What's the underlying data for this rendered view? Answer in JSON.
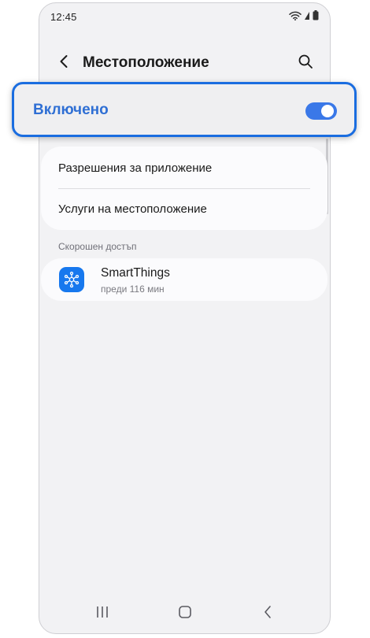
{
  "status_bar": {
    "time": "12:45",
    "icons": [
      "wifi-icon",
      "signal-icon",
      "battery-icon"
    ]
  },
  "header": {
    "title": "Местоположение",
    "back_icon": "chevron-left-icon",
    "search_icon": "search-icon"
  },
  "location_toggle": {
    "label": "Включено",
    "state": "on"
  },
  "menu": {
    "items": [
      {
        "label": "Разрешения за приложение"
      },
      {
        "label": "Услуги на местоположение"
      }
    ]
  },
  "recent_access": {
    "section_label": "Скорошен достъп",
    "apps": [
      {
        "name": "SmartThings",
        "time": "преди 116 мин",
        "icon": "smartthings-icon"
      }
    ]
  },
  "nav_bar": {
    "buttons": [
      "recent-apps-icon",
      "home-icon",
      "back-icon"
    ]
  },
  "colors": {
    "accent": "#3a78e8",
    "highlight_border": "#1a6de0",
    "toggle_label": "#2f6fd4",
    "background": "#f2f2f4",
    "card": "#fbfbfd",
    "app_icon": "#1778ee"
  }
}
